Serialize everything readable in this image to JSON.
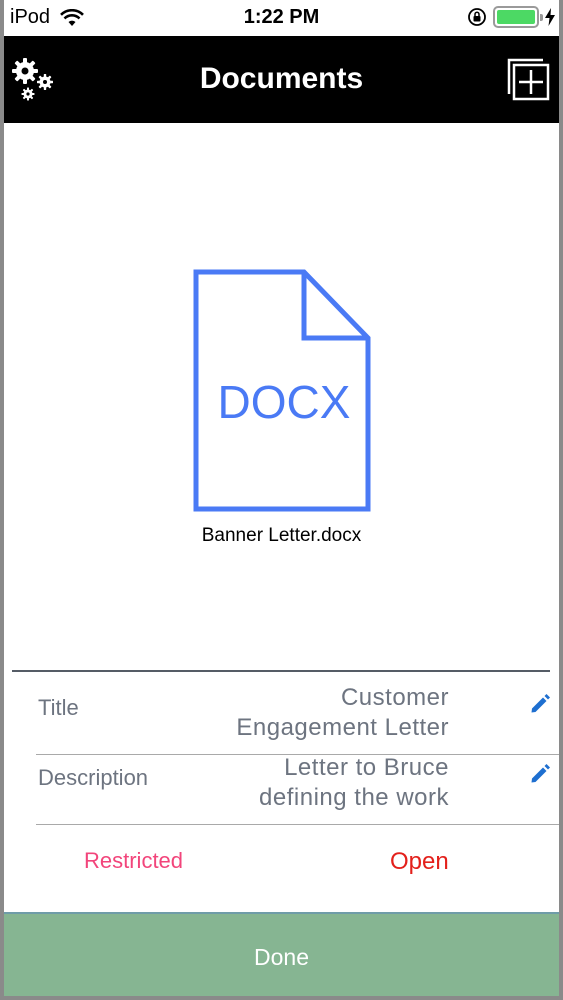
{
  "status_bar": {
    "carrier": "iPod",
    "time": "1:22 PM",
    "battery_level": 1.0
  },
  "nav": {
    "title": "Documents",
    "left_icon": "gear-icon",
    "right_icon": "add-document-icon"
  },
  "document": {
    "type_label": "DOCX",
    "file_name": "Banner Letter.docx",
    "icon_color": "#4a7af5"
  },
  "fields": [
    {
      "label": "Title",
      "value": "Customer Engagement Letter"
    },
    {
      "label": "Description",
      "value": "Letter to Bruce defining the work"
    }
  ],
  "access": {
    "restricted_label": "Restricted",
    "open_label": "Open",
    "restricted_color": "#f2457b",
    "open_color": "#e3201b"
  },
  "footer": {
    "done_label": "Done",
    "done_color": "#86b592"
  }
}
